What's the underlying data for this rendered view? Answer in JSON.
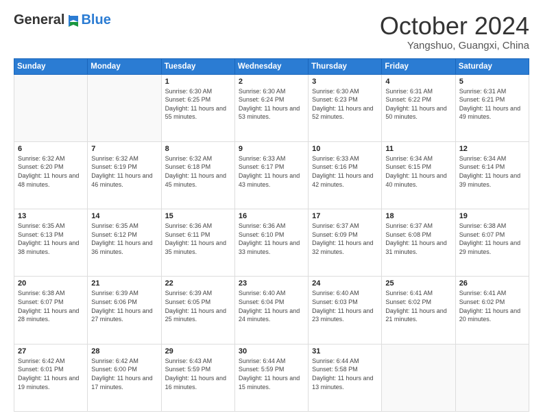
{
  "logo": {
    "general": "General",
    "blue": "Blue"
  },
  "header": {
    "month": "October 2024",
    "location": "Yangshuo, Guangxi, China"
  },
  "weekdays": [
    "Sunday",
    "Monday",
    "Tuesday",
    "Wednesday",
    "Thursday",
    "Friday",
    "Saturday"
  ],
  "weeks": [
    [
      {
        "day": "",
        "info": ""
      },
      {
        "day": "",
        "info": ""
      },
      {
        "day": "1",
        "sunrise": "Sunrise: 6:30 AM",
        "sunset": "Sunset: 6:25 PM",
        "daylight": "Daylight: 11 hours and 55 minutes."
      },
      {
        "day": "2",
        "sunrise": "Sunrise: 6:30 AM",
        "sunset": "Sunset: 6:24 PM",
        "daylight": "Daylight: 11 hours and 53 minutes."
      },
      {
        "day": "3",
        "sunrise": "Sunrise: 6:30 AM",
        "sunset": "Sunset: 6:23 PM",
        "daylight": "Daylight: 11 hours and 52 minutes."
      },
      {
        "day": "4",
        "sunrise": "Sunrise: 6:31 AM",
        "sunset": "Sunset: 6:22 PM",
        "daylight": "Daylight: 11 hours and 50 minutes."
      },
      {
        "day": "5",
        "sunrise": "Sunrise: 6:31 AM",
        "sunset": "Sunset: 6:21 PM",
        "daylight": "Daylight: 11 hours and 49 minutes."
      }
    ],
    [
      {
        "day": "6",
        "sunrise": "Sunrise: 6:32 AM",
        "sunset": "Sunset: 6:20 PM",
        "daylight": "Daylight: 11 hours and 48 minutes."
      },
      {
        "day": "7",
        "sunrise": "Sunrise: 6:32 AM",
        "sunset": "Sunset: 6:19 PM",
        "daylight": "Daylight: 11 hours and 46 minutes."
      },
      {
        "day": "8",
        "sunrise": "Sunrise: 6:32 AM",
        "sunset": "Sunset: 6:18 PM",
        "daylight": "Daylight: 11 hours and 45 minutes."
      },
      {
        "day": "9",
        "sunrise": "Sunrise: 6:33 AM",
        "sunset": "Sunset: 6:17 PM",
        "daylight": "Daylight: 11 hours and 43 minutes."
      },
      {
        "day": "10",
        "sunrise": "Sunrise: 6:33 AM",
        "sunset": "Sunset: 6:16 PM",
        "daylight": "Daylight: 11 hours and 42 minutes."
      },
      {
        "day": "11",
        "sunrise": "Sunrise: 6:34 AM",
        "sunset": "Sunset: 6:15 PM",
        "daylight": "Daylight: 11 hours and 40 minutes."
      },
      {
        "day": "12",
        "sunrise": "Sunrise: 6:34 AM",
        "sunset": "Sunset: 6:14 PM",
        "daylight": "Daylight: 11 hours and 39 minutes."
      }
    ],
    [
      {
        "day": "13",
        "sunrise": "Sunrise: 6:35 AM",
        "sunset": "Sunset: 6:13 PM",
        "daylight": "Daylight: 11 hours and 38 minutes."
      },
      {
        "day": "14",
        "sunrise": "Sunrise: 6:35 AM",
        "sunset": "Sunset: 6:12 PM",
        "daylight": "Daylight: 11 hours and 36 minutes."
      },
      {
        "day": "15",
        "sunrise": "Sunrise: 6:36 AM",
        "sunset": "Sunset: 6:11 PM",
        "daylight": "Daylight: 11 hours and 35 minutes."
      },
      {
        "day": "16",
        "sunrise": "Sunrise: 6:36 AM",
        "sunset": "Sunset: 6:10 PM",
        "daylight": "Daylight: 11 hours and 33 minutes."
      },
      {
        "day": "17",
        "sunrise": "Sunrise: 6:37 AM",
        "sunset": "Sunset: 6:09 PM",
        "daylight": "Daylight: 11 hours and 32 minutes."
      },
      {
        "day": "18",
        "sunrise": "Sunrise: 6:37 AM",
        "sunset": "Sunset: 6:08 PM",
        "daylight": "Daylight: 11 hours and 31 minutes."
      },
      {
        "day": "19",
        "sunrise": "Sunrise: 6:38 AM",
        "sunset": "Sunset: 6:07 PM",
        "daylight": "Daylight: 11 hours and 29 minutes."
      }
    ],
    [
      {
        "day": "20",
        "sunrise": "Sunrise: 6:38 AM",
        "sunset": "Sunset: 6:07 PM",
        "daylight": "Daylight: 11 hours and 28 minutes."
      },
      {
        "day": "21",
        "sunrise": "Sunrise: 6:39 AM",
        "sunset": "Sunset: 6:06 PM",
        "daylight": "Daylight: 11 hours and 27 minutes."
      },
      {
        "day": "22",
        "sunrise": "Sunrise: 6:39 AM",
        "sunset": "Sunset: 6:05 PM",
        "daylight": "Daylight: 11 hours and 25 minutes."
      },
      {
        "day": "23",
        "sunrise": "Sunrise: 6:40 AM",
        "sunset": "Sunset: 6:04 PM",
        "daylight": "Daylight: 11 hours and 24 minutes."
      },
      {
        "day": "24",
        "sunrise": "Sunrise: 6:40 AM",
        "sunset": "Sunset: 6:03 PM",
        "daylight": "Daylight: 11 hours and 23 minutes."
      },
      {
        "day": "25",
        "sunrise": "Sunrise: 6:41 AM",
        "sunset": "Sunset: 6:02 PM",
        "daylight": "Daylight: 11 hours and 21 minutes."
      },
      {
        "day": "26",
        "sunrise": "Sunrise: 6:41 AM",
        "sunset": "Sunset: 6:02 PM",
        "daylight": "Daylight: 11 hours and 20 minutes."
      }
    ],
    [
      {
        "day": "27",
        "sunrise": "Sunrise: 6:42 AM",
        "sunset": "Sunset: 6:01 PM",
        "daylight": "Daylight: 11 hours and 19 minutes."
      },
      {
        "day": "28",
        "sunrise": "Sunrise: 6:42 AM",
        "sunset": "Sunset: 6:00 PM",
        "daylight": "Daylight: 11 hours and 17 minutes."
      },
      {
        "day": "29",
        "sunrise": "Sunrise: 6:43 AM",
        "sunset": "Sunset: 5:59 PM",
        "daylight": "Daylight: 11 hours and 16 minutes."
      },
      {
        "day": "30",
        "sunrise": "Sunrise: 6:44 AM",
        "sunset": "Sunset: 5:59 PM",
        "daylight": "Daylight: 11 hours and 15 minutes."
      },
      {
        "day": "31",
        "sunrise": "Sunrise: 6:44 AM",
        "sunset": "Sunset: 5:58 PM",
        "daylight": "Daylight: 11 hours and 13 minutes."
      },
      {
        "day": "",
        "info": ""
      },
      {
        "day": "",
        "info": ""
      }
    ]
  ]
}
